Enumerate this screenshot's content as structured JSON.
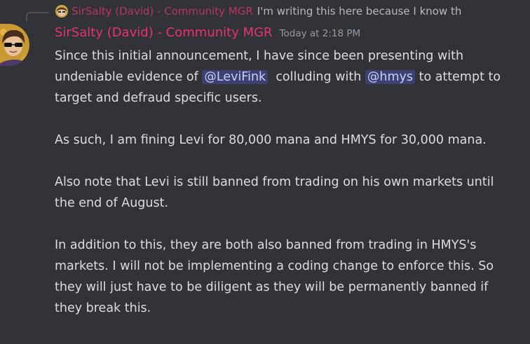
{
  "reply": {
    "author": "SirSalty (David) - Community MGR",
    "preview": "I'm writing this here because I know th"
  },
  "message": {
    "author": "SirSalty (David) - Community MGR",
    "timestamp": "Today at 2:18 PM",
    "p1_a": "Since this initial announcement, I have since been presenting with undeniable evidence of ",
    "mention1": "@LeviFink",
    "p1_b": "  colluding with ",
    "mention2": "@hmys",
    "p1_c": " to attempt to target and defraud specific users.",
    "p2": "As such, I am fining Levi for 80,000 mana and HMYS for 30,000 mana.",
    "p3": "Also note that Levi is still banned from trading on his own markets until the end of August.",
    "p4": "In addition to this, they are both also banned from trading in HMYS's markets. I will not be implementing a coding change to enforce this. So they will just have to be diligent as they will be permanently banned if they break this."
  },
  "colors": {
    "background": "#313338",
    "author": "#e8336a",
    "text": "#dbdee1",
    "mention_bg": "#3c4270",
    "mention_text": "#c9cdfb",
    "timestamp": "#949ba4"
  }
}
